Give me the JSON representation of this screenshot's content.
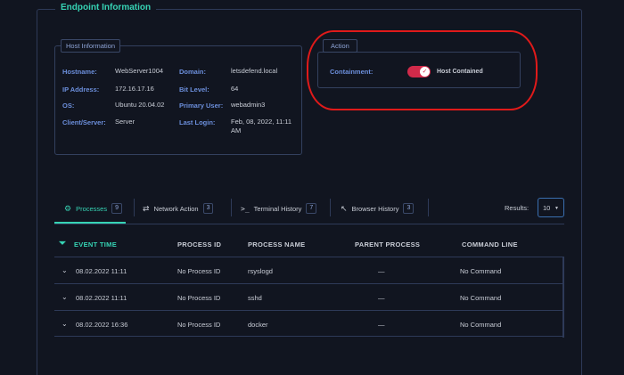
{
  "panel": {
    "title": "Endpoint Information"
  },
  "host": {
    "tag": "Host Information",
    "hostname_label": "Hostname:",
    "hostname": "WebServer1004",
    "ip_label": "IP Address:",
    "ip": "172.16.17.16",
    "os_label": "OS:",
    "os": "Ubuntu 20.04.02",
    "role_label": "Client/Server:",
    "role": "Server",
    "domain_label": "Domain:",
    "domain": "letsdefend.local",
    "bit_label": "Bit Level:",
    "bit": "64",
    "user_label": "Primary User:",
    "user": "webadmin3",
    "login_label": "Last Login:",
    "login": "Feb, 08, 2022, 11:11 AM"
  },
  "action": {
    "tag": "Action",
    "containment_label": "Containment:",
    "toggle_on": true,
    "status": "Host Contained"
  },
  "tabs": [
    {
      "label": "Processes",
      "count": "9",
      "icon": "gear-icon"
    },
    {
      "label": "Network Action",
      "count": "3",
      "icon": "network-icon"
    },
    {
      "label": "Terminal History",
      "count": "7",
      "icon": "terminal-icon"
    },
    {
      "label": "Browser History",
      "count": "3",
      "icon": "cursor-icon"
    }
  ],
  "results": {
    "label": "Results:",
    "value": "10"
  },
  "table": {
    "headers": [
      "EVENT TIME",
      "PROCESS ID",
      "PROCESS NAME",
      "PARENT PROCESS",
      "COMMAND LINE"
    ],
    "rows": [
      [
        "08.02.2022 11:11",
        "No Process ID",
        "rsyslogd",
        "—",
        "No Command"
      ],
      [
        "08.02.2022 11:11",
        "No Process ID",
        "sshd",
        "—",
        "No Command"
      ],
      [
        "08.02.2022 16:36",
        "No Process ID",
        "docker",
        "—",
        "No Command"
      ]
    ]
  },
  "colors": {
    "accent": "#36d3b4",
    "label_blue": "#6c8fdc",
    "toggle_red": "#d12a4a",
    "annotation_red": "#e01a1a"
  }
}
